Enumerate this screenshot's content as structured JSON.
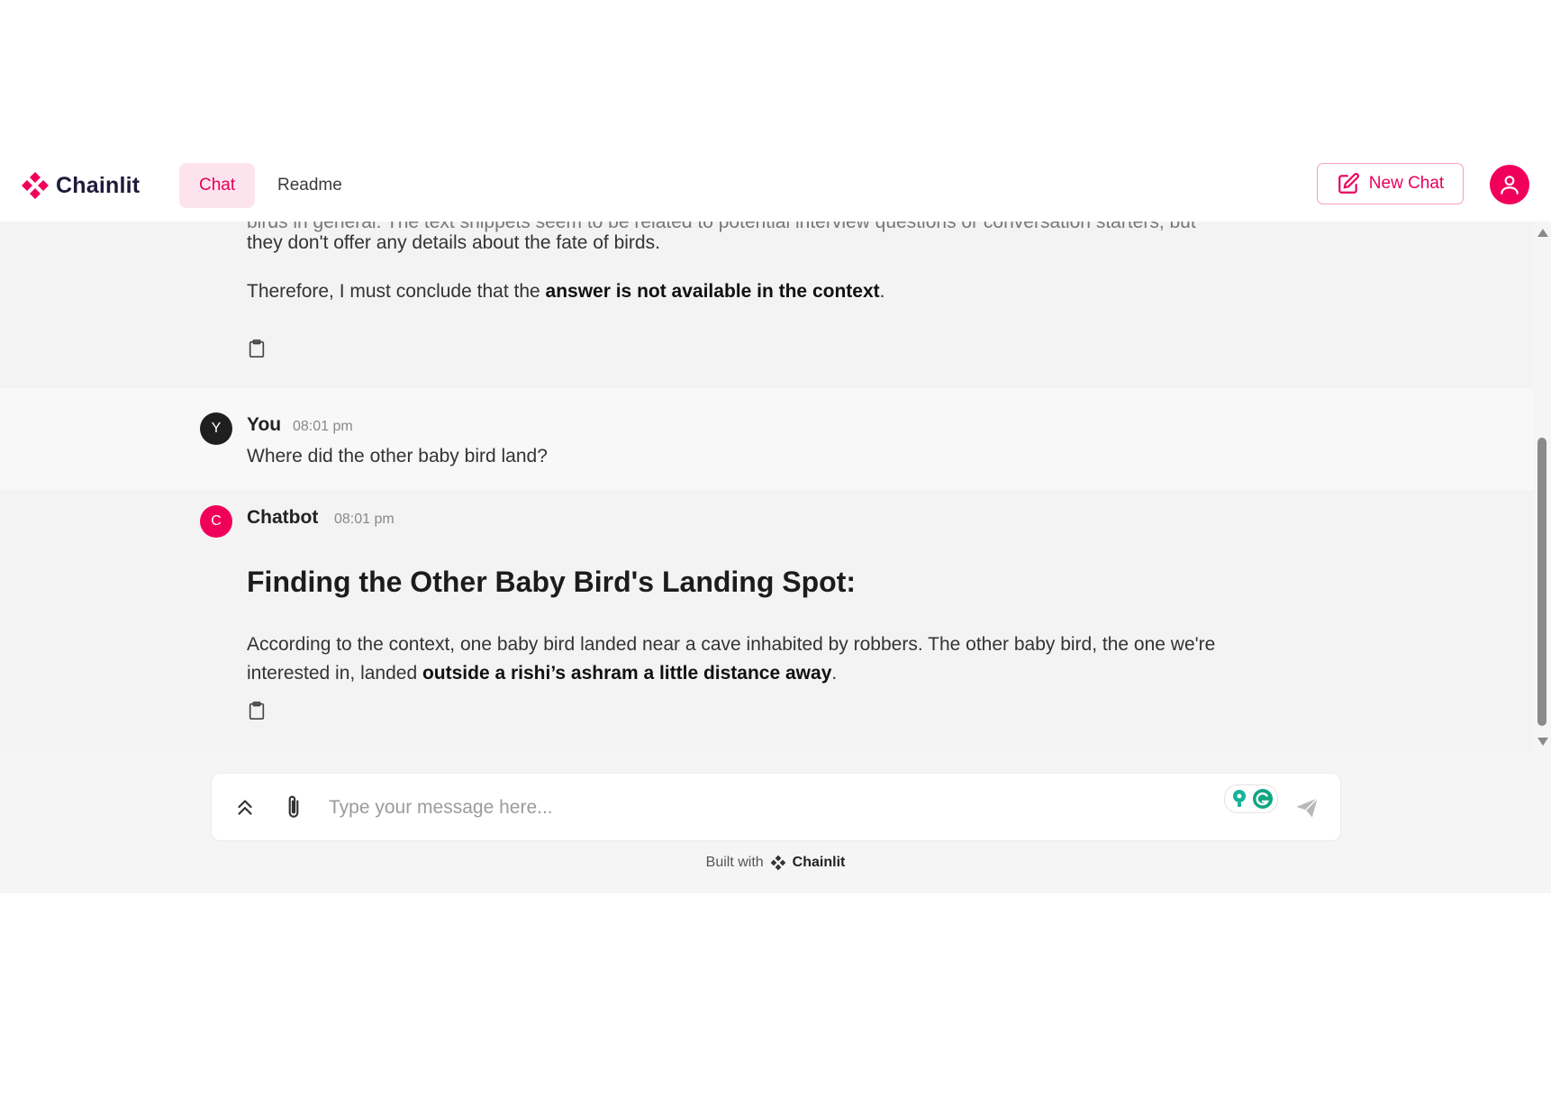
{
  "header": {
    "brand": "Chainlit",
    "tabs": [
      {
        "label": "Chat",
        "active": true
      },
      {
        "label": "Readme",
        "active": false
      }
    ],
    "new_chat_label": "New Chat"
  },
  "messages": {
    "prev_bot": {
      "cut_line": "birds in general. The text snippets seem to be related to potential interview questions or conversation starters, but",
      "line1": "they don't offer any details about the fate of birds.",
      "conclusion_prefix": "Therefore, I must conclude that the ",
      "conclusion_bold": "answer is not available in the context",
      "conclusion_suffix": "."
    },
    "user": {
      "avatar_letter": "Y",
      "author": "You",
      "time": "08:01 pm",
      "text": "Where did the other baby bird land?"
    },
    "bot": {
      "avatar_letter": "C",
      "author": "Chatbot",
      "time": "08:01 pm",
      "heading": "Finding the Other Baby Bird's Landing Spot:",
      "para_line1": "According to the context, one baby bird landed near a cave inhabited by robbers. The other baby bird, the one we're",
      "para_line2_prefix": "interested in, landed ",
      "para_line2_bold": "outside a rishi’s ashram a little distance away",
      "para_line2_suffix": "."
    }
  },
  "composer": {
    "placeholder": "Type your message here..."
  },
  "footer": {
    "built_with": "Built with",
    "brand": "Chainlit"
  },
  "colors": {
    "accent": "#e6005c",
    "accent_light": "#fde4ec",
    "user_avatar": "#1f1f1f"
  }
}
